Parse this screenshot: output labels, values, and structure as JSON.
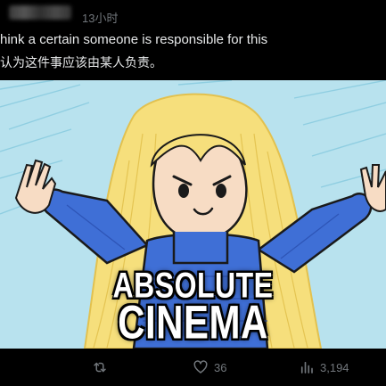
{
  "tweet": {
    "timestamp": "13小时",
    "text": "hink a certain someone is responsible for this",
    "translation": "认为这件事应该由某人负责。"
  },
  "media": {
    "caption_line1": "ABSOLUTE",
    "caption_line2": "CINEMA"
  },
  "actions": {
    "retweet_icon": "retweet-icon",
    "like_icon": "heart-icon",
    "like_count": "36",
    "views_icon": "bar-chart-icon",
    "views_count": "3,194"
  },
  "colors": {
    "background": "#000000",
    "text": "#e7e9ea",
    "muted": "#71767b"
  }
}
